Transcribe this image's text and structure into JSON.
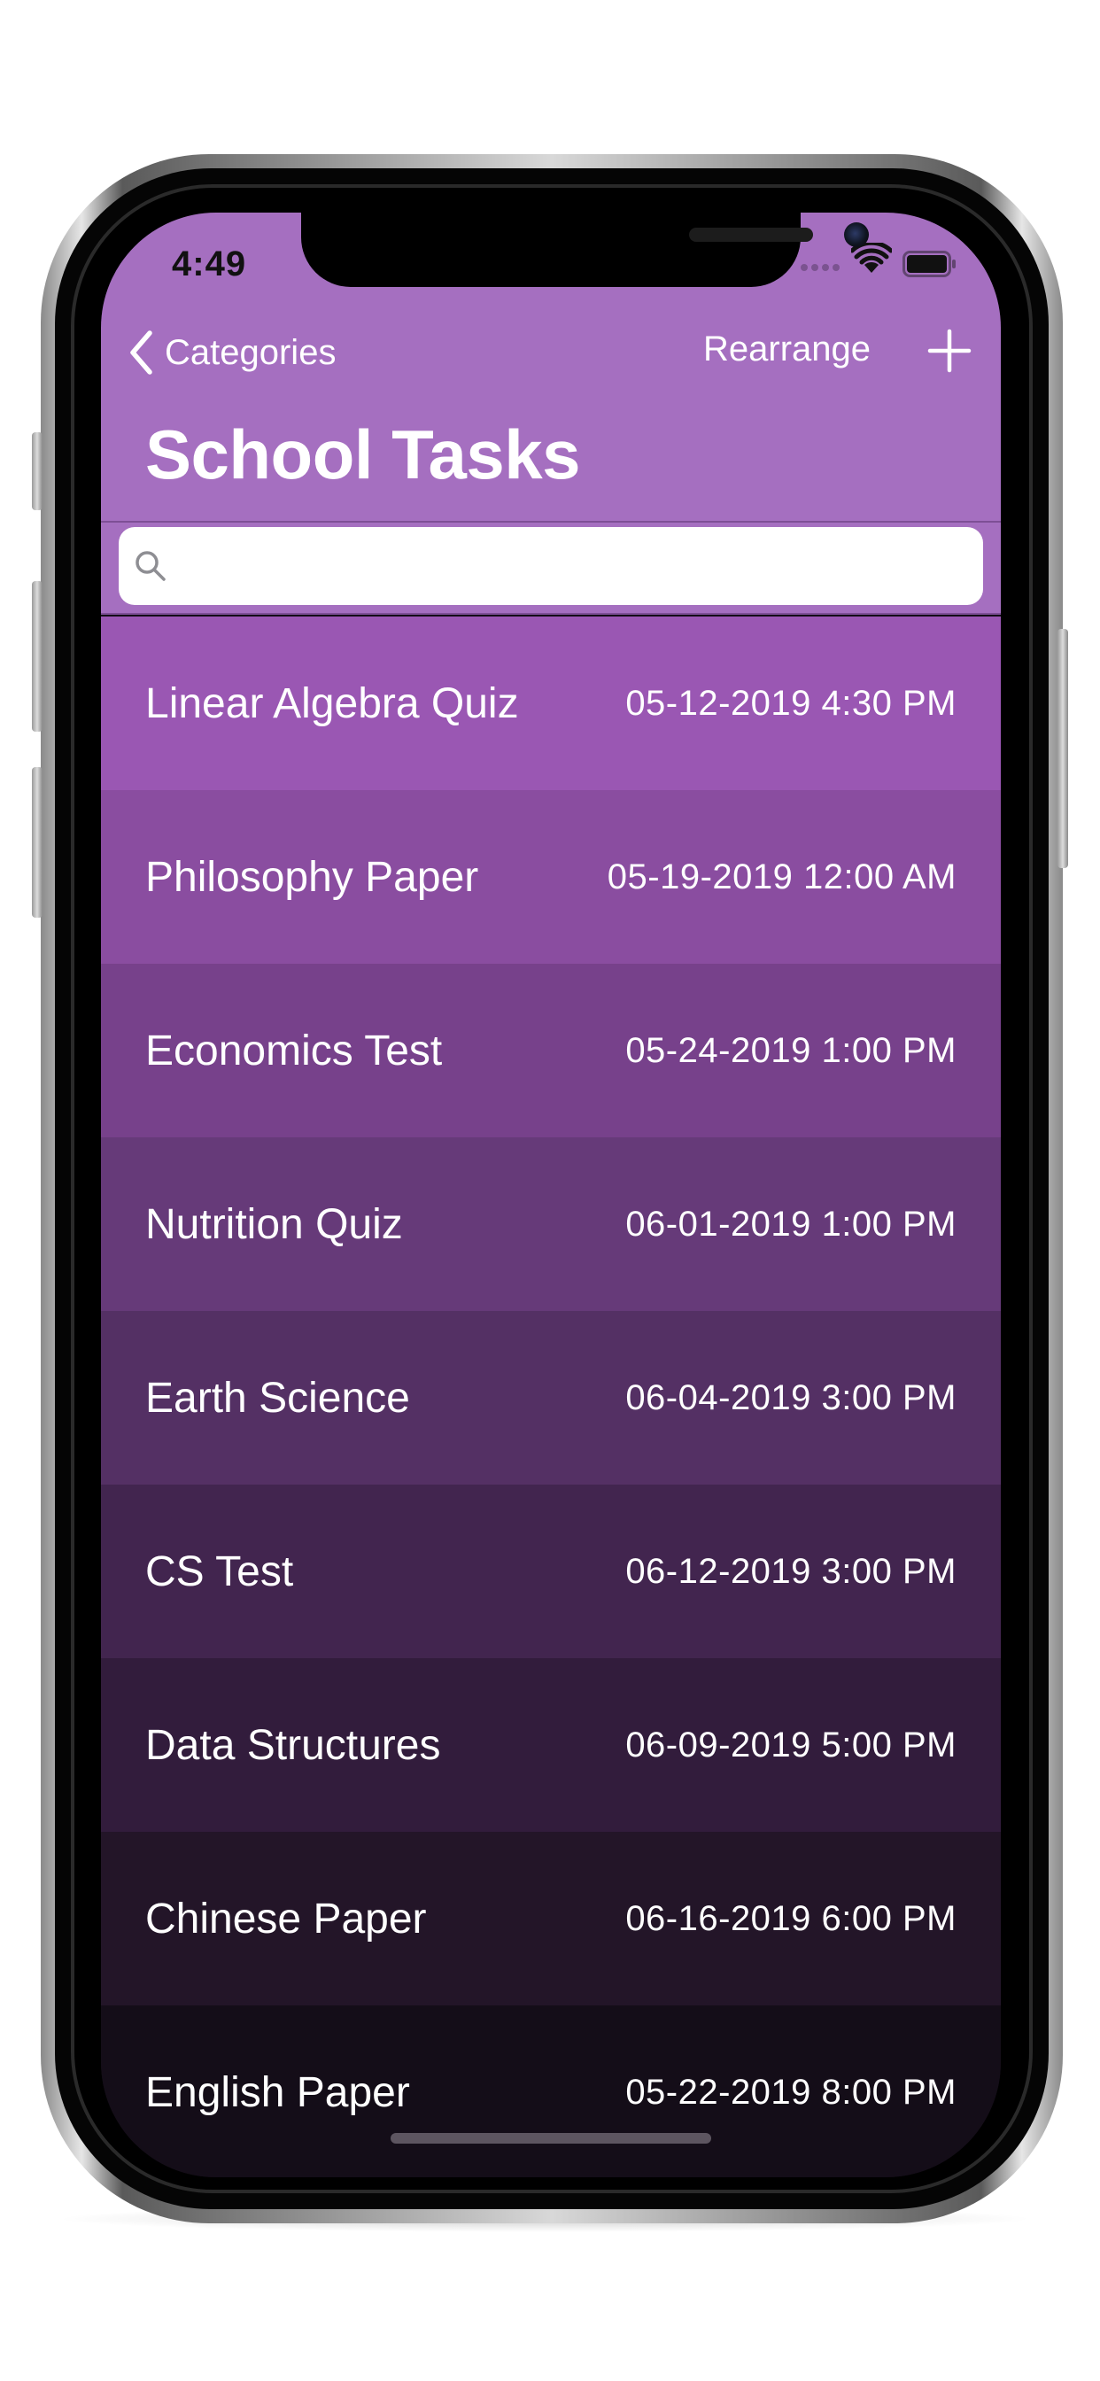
{
  "status_bar": {
    "time": "4:49",
    "icons": [
      "signal-dots-icon",
      "wifi-icon",
      "battery-icon"
    ]
  },
  "nav": {
    "back_label": "Categories",
    "rearrange_label": "Rearrange",
    "add_icon": "plus-icon",
    "back_icon": "chevron-left-icon"
  },
  "title": "School Tasks",
  "search": {
    "placeholder": "",
    "value": "",
    "icon": "search-icon"
  },
  "colors": {
    "nav_background": "#a56fc0",
    "row_colors": [
      "#9a57b3",
      "#8a4da0",
      "#77418b",
      "#663a79",
      "#543064",
      "#42254f",
      "#321c3c",
      "#231528",
      "#140d18"
    ]
  },
  "tasks": [
    {
      "name": "Linear Algebra Quiz",
      "date": "05-12-2019 4:30 PM"
    },
    {
      "name": "Philosophy Paper",
      "date": "05-19-2019 12:00 AM"
    },
    {
      "name": "Economics Test",
      "date": "05-24-2019 1:00 PM"
    },
    {
      "name": "Nutrition Quiz",
      "date": "06-01-2019 1:00 PM"
    },
    {
      "name": "Earth Science",
      "date": "06-04-2019 3:00 PM"
    },
    {
      "name": "CS Test",
      "date": "06-12-2019 3:00 PM"
    },
    {
      "name": "Data Structures",
      "date": "06-09-2019 5:00 PM"
    },
    {
      "name": "Chinese Paper",
      "date": "06-16-2019 6:00 PM"
    },
    {
      "name": "English Paper",
      "date": "05-22-2019 8:00 PM"
    }
  ]
}
